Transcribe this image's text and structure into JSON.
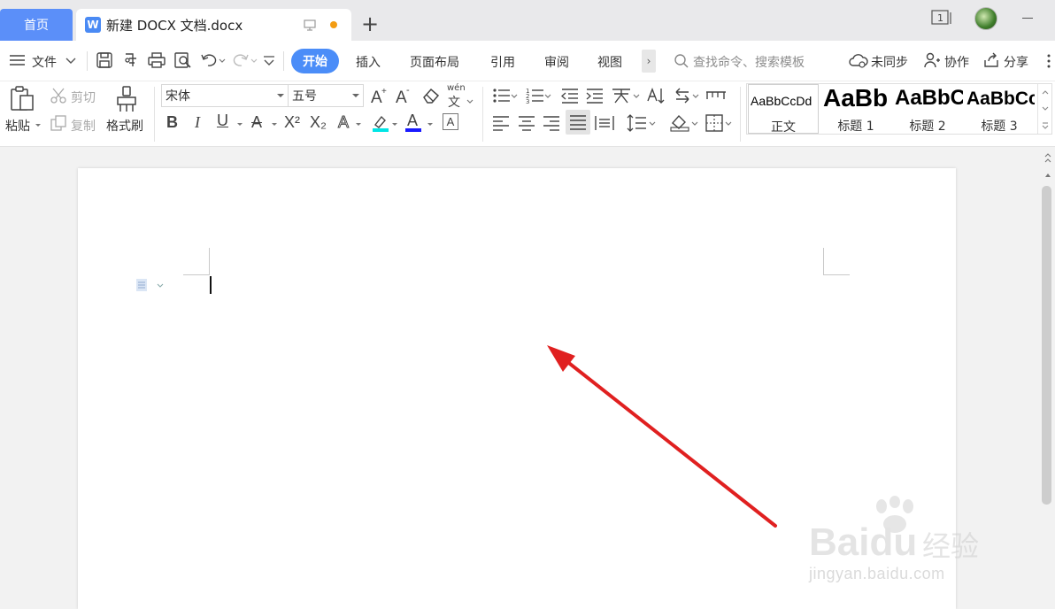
{
  "tabs": {
    "home": "首页",
    "document": "新建 DOCX 文档.docx",
    "doc_icon": "W",
    "new_tab": "+",
    "window_count": "1"
  },
  "menu": {
    "file": "文件",
    "items": [
      "开始",
      "插入",
      "页面布局",
      "引用",
      "审阅",
      "视图"
    ],
    "more": "›",
    "search_placeholder": "查找命令、搜索模板",
    "sync": "未同步",
    "collaborate": "协作",
    "share": "分享"
  },
  "ribbon": {
    "paste": "粘贴",
    "cut": "剪切",
    "copy": "复制",
    "format_painter": "格式刷",
    "font_name": "宋体",
    "font_size": "五号",
    "pinyin": "wén",
    "bold": "B",
    "italic": "I",
    "underline": "U",
    "strike": "A",
    "superscript": "X²",
    "subscript": "X₂",
    "text_effect": "A",
    "font_color": "A",
    "char_border": "A"
  },
  "styles": [
    {
      "sample": "AaBbCcDd",
      "name": "正文"
    },
    {
      "sample": "AaBb",
      "name": "标题 1"
    },
    {
      "sample": "AaBbC",
      "name": "标题 2"
    },
    {
      "sample": "AaBbCc",
      "name": "标题 3"
    }
  ],
  "watermark": {
    "logo": "Baidu",
    "cn": "经验",
    "sub": "jingyan.baidu.com"
  },
  "colors": {
    "accent": "#4b8df8",
    "home_tab": "#5b8ff9",
    "arrow": "#e02020",
    "highlight": "#00e5e5",
    "font_color_bar": "#1a1aff"
  }
}
